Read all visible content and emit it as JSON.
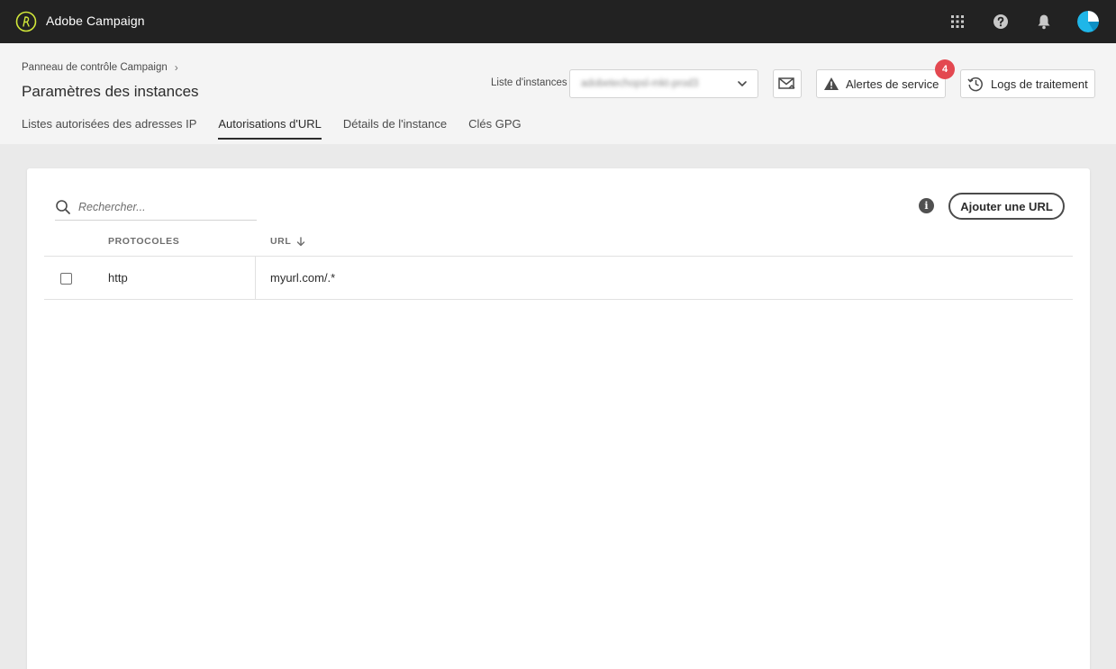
{
  "app": {
    "title": "Adobe Campaign"
  },
  "header": {
    "breadcrumb": "Panneau de contrôle Campaign",
    "page_title": "Paramètres des instances",
    "instances_label": "Liste d'instances",
    "instances_value": "adobetechopsl-mkt-prod3",
    "alerts_label": "Alertes de service",
    "alerts_count": "4",
    "logs_label": "Logs de traitement"
  },
  "tabs": [
    {
      "label": "Listes autorisées des adresses IP",
      "active": false
    },
    {
      "label": "Autorisations d'URL",
      "active": true
    },
    {
      "label": "Détails de l'instance",
      "active": false
    },
    {
      "label": "Clés GPG",
      "active": false
    }
  ],
  "toolbar": {
    "search_placeholder": "Rechercher...",
    "add_url_label": "Ajouter une URL"
  },
  "table": {
    "columns": [
      "PROTOCOLES",
      "URL"
    ],
    "rows": [
      {
        "protocol": "http",
        "url": "myurl.com/.*"
      }
    ]
  },
  "colors": {
    "topbar": "#222222",
    "logo_accent": "#d2e83a",
    "avatar": "#1fb6e8",
    "alert_badge": "#e34850"
  },
  "icons": [
    "adobe-campaign-logo-icon",
    "apps-grid-icon",
    "help-icon",
    "bell-icon",
    "avatar",
    "chevron-down-icon",
    "mail-icon",
    "alert-triangle-icon",
    "history-icon",
    "search-icon",
    "info-icon",
    "sort-down-arrow-icon",
    "checkbox"
  ]
}
